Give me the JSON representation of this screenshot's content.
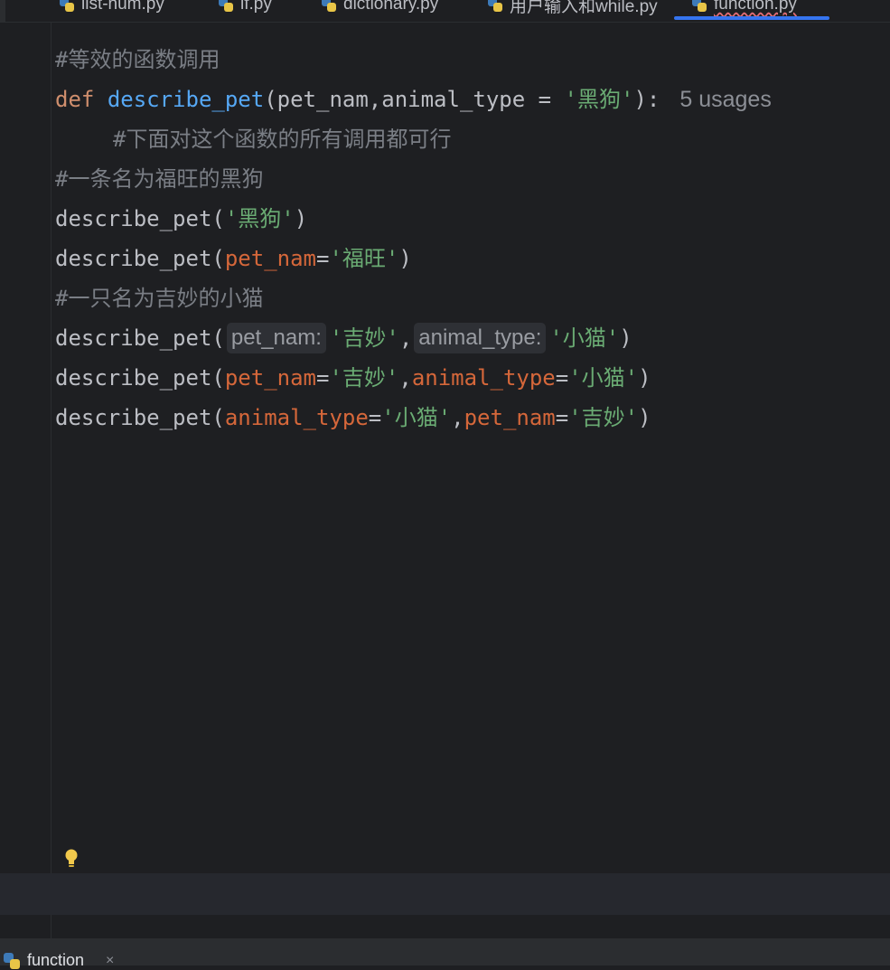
{
  "tabs": [
    {
      "label": "list-num.py"
    },
    {
      "label": "if.py"
    },
    {
      "label": "dictionary.py"
    },
    {
      "label": "用户输入和while.py"
    },
    {
      "label": "function.py",
      "active": true
    }
  ],
  "code": {
    "line1": "#等效的函数调用",
    "line2": {
      "def": "def",
      "fn": "describe_pet",
      "open": "(pet_nam,animal_type = ",
      "str": "'黑狗'",
      "close": "):",
      "usages": "5 usages"
    },
    "line3": "#下面对这个函数的所有调用都可行",
    "line4": "#一条名为福旺的黑狗",
    "line5": {
      "fn": "describe_pet(",
      "str": "'黑狗'",
      "close": ")"
    },
    "line6": {
      "fn": "describe_pet(",
      "arg": "pet_nam",
      "eq": "=",
      "str": "'福旺'",
      "close": ")"
    },
    "line7": "#一只名为吉妙的小猫",
    "line8": {
      "fn": "describe_pet(",
      "hint1": "pet_nam:",
      "str1": "'吉妙'",
      "comma": ",",
      "hint2": "animal_type:",
      "str2": "'小猫'",
      "close": ")"
    },
    "line9": {
      "fn": "describe_pet(",
      "arg1": "pet_nam",
      "eq1": "=",
      "str1": "'吉妙'",
      "comma": ",",
      "arg2": "animal_type",
      "eq2": "=",
      "str2": "'小猫'",
      "close": ")"
    },
    "line10": {
      "fn": "describe_pet(",
      "arg1": "animal_type",
      "eq1": "=",
      "str1": "'小猫'",
      "comma": ",",
      "arg2": "pet_nam",
      "eq2": "=",
      "str2": "'吉妙'",
      "close": ")"
    }
  },
  "bottom": {
    "run_tab": "function",
    "close": "×"
  },
  "icons": {
    "tab_file": "python-file-icon",
    "bulb": "lightbulb-icon"
  },
  "colors": {
    "background": "#1e1f22",
    "keyword": "#cf8e6d",
    "function": "#56a8f5",
    "string": "#6aab73",
    "named_arg": "#d5673a",
    "comment": "#7a7e85",
    "accent": "#3574f0"
  }
}
